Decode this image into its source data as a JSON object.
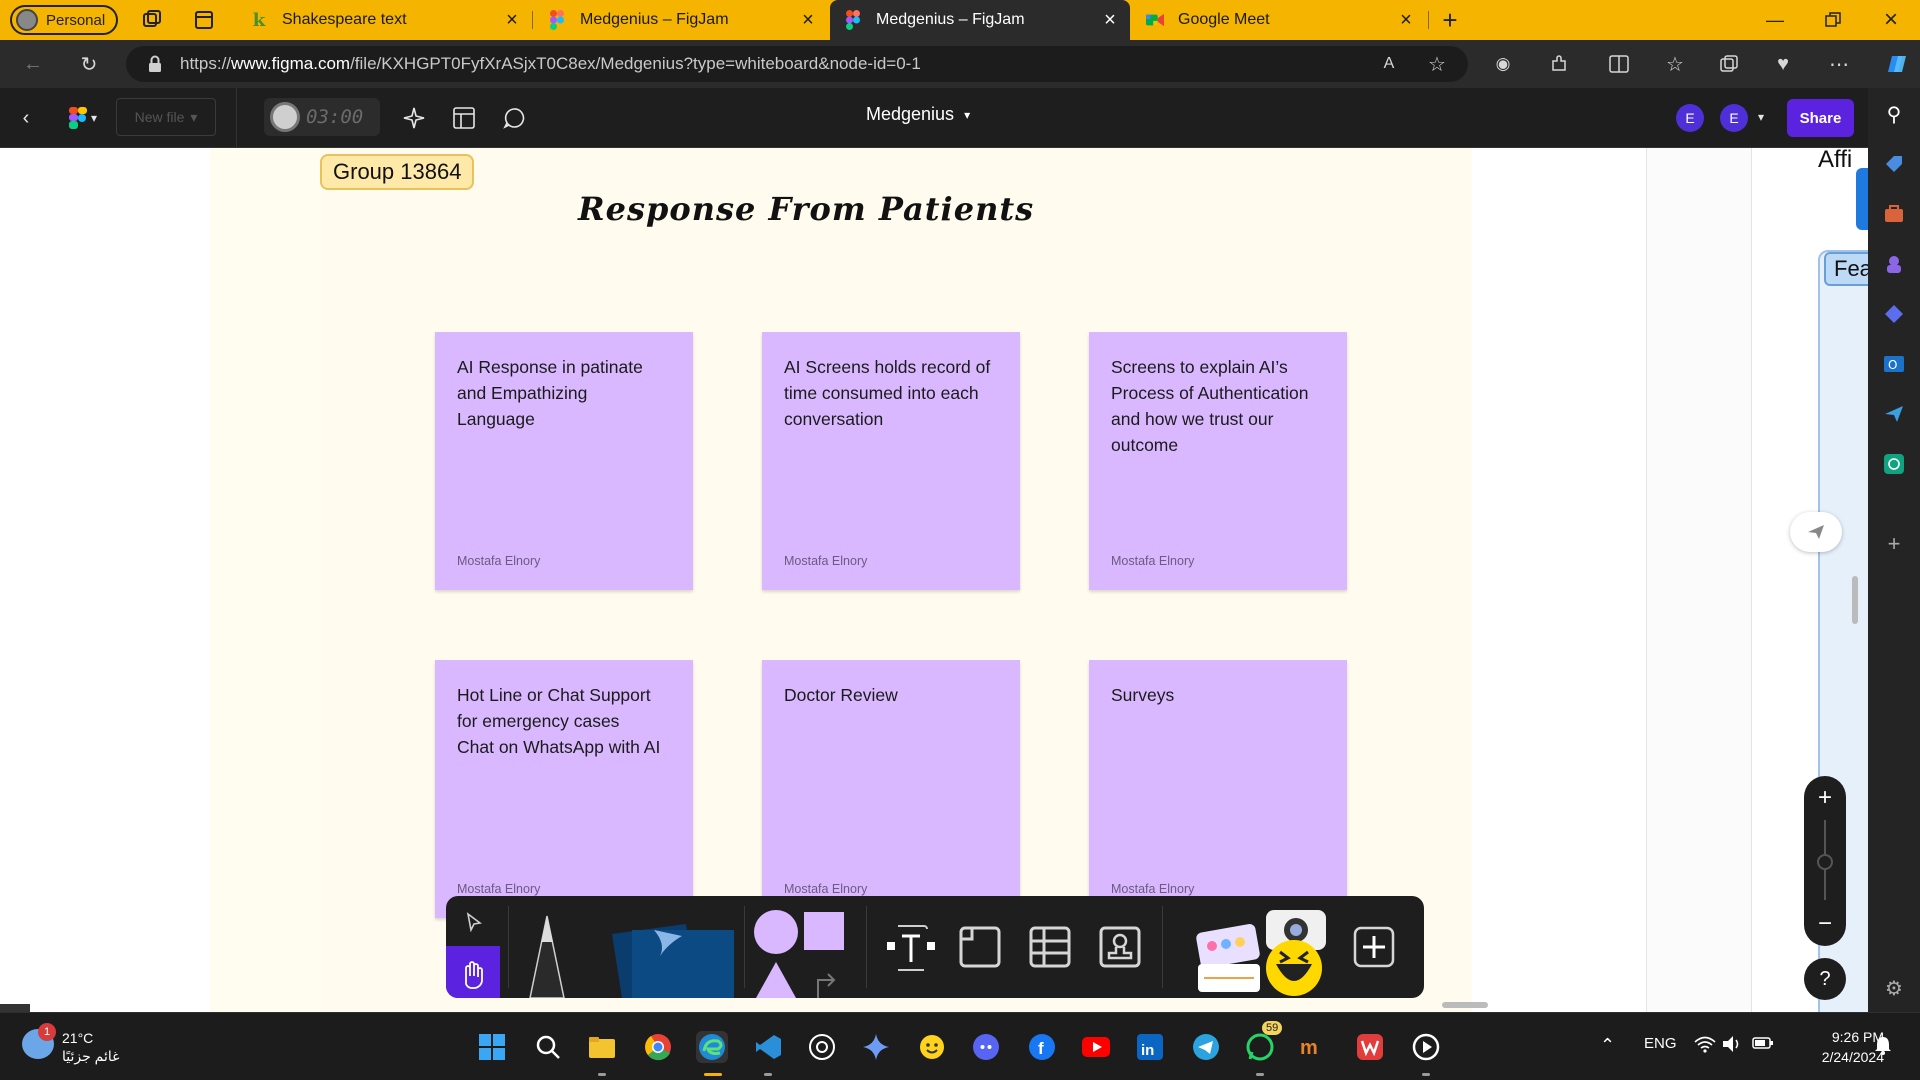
{
  "browser": {
    "profile_label": "Personal",
    "tabs": [
      {
        "title": "Shakespeare text",
        "favicon": "k"
      },
      {
        "title": "Medgenius – FigJam",
        "favicon": "figma-icon"
      },
      {
        "title": "Medgenius – FigJam",
        "favicon": "figma-icon",
        "active": true
      },
      {
        "title": "Google Meet",
        "favicon": "google-meet-icon"
      }
    ],
    "url_prefix": "https://",
    "url_host": "www.figma.com",
    "url_path": "/file/KXHGPT0FyfXrASjxT0C8ex/Medgenius?type=whiteboard&node-id=0-1"
  },
  "figma": {
    "new_file_label": "New file",
    "timer": "03:00",
    "file_title": "Medgenius",
    "avatars": [
      "E",
      "E"
    ],
    "share_label": "Share"
  },
  "board": {
    "group_label": "Group 13864",
    "title": "Response From Patients",
    "stickies": [
      {
        "text": "AI Response in patinate\nand Empathizing\nLanguage",
        "author": "Mostafa Elnory"
      },
      {
        "text": "AI Screens holds record of\ntime consumed into each\nconversation",
        "author": "Mostafa Elnory"
      },
      {
        "text": "Screens to explain AI’s\nProcess of Authentication\nand how we trust our\noutcome",
        "author": "Mostafa Elnory"
      },
      {
        "text": "Hot Line or Chat Support\nfor emergency cases\nChat on WhatsApp with AI",
        "author": "Mostafa Elnory"
      },
      {
        "text": "Doctor Review",
        "author": "Mostafa Elnory"
      },
      {
        "text": "Surveys",
        "author": "Mostafa Elnory"
      }
    ],
    "side_text_1": "Affi",
    "side_text_2": "Fea",
    "sticky_color": "#d9b8ff"
  },
  "taskbar": {
    "temperature": "21°C",
    "weather_desc": "غائم جزئيًا",
    "weather_badge": "1",
    "whatsapp_badge": "59",
    "language": "ENG",
    "time": "9:26 PM",
    "date": "2/24/2024"
  },
  "colors": {
    "tab_strip": "#f4b400",
    "share_button": "#5b23e0",
    "sticky": "#d9b8ff"
  }
}
